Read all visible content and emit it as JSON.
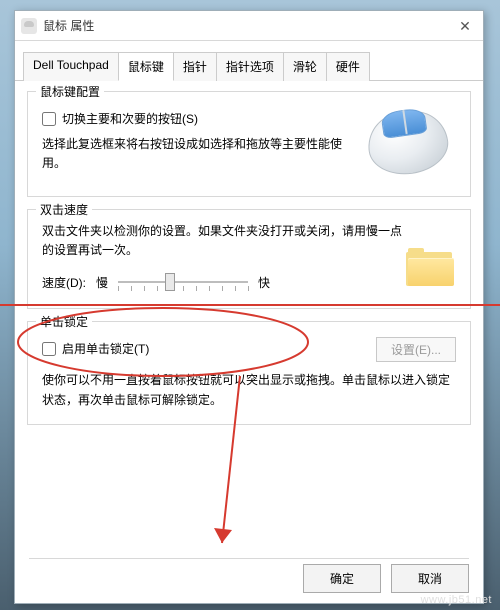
{
  "window": {
    "title": "鼠标 属性"
  },
  "tabs": [
    "Dell Touchpad",
    "鼠标键",
    "指针",
    "指针选项",
    "滑轮",
    "硬件"
  ],
  "active_tab_index": 1,
  "group1": {
    "title": "鼠标键配置",
    "checkbox_label": "切换主要和次要的按钮(S)",
    "checkbox_checked": false,
    "desc": "选择此复选框来将右按钮设成如选择和拖放等主要性能使用。"
  },
  "group2": {
    "title": "双击速度",
    "desc": "双击文件夹以检测你的设置。如果文件夹没打开或关闭，请用慢一点的设置再试一次。",
    "speed_label": "速度(D):",
    "slow_label": "慢",
    "fast_label": "快",
    "slider_value": 4,
    "slider_min": 0,
    "slider_max": 10
  },
  "group3": {
    "title": "单击锁定",
    "checkbox_label": "启用单击锁定(T)",
    "checkbox_checked": false,
    "settings_button": "设置(E)...",
    "settings_enabled": false,
    "desc": "使你可以不用一直按着鼠标按钮就可以突出显示或拖拽。单击鼠标以进入锁定状态，再次单击鼠标可解除锁定。"
  },
  "footer": {
    "ok": "确定",
    "cancel": "取消"
  },
  "watermark": "www.jb51.net"
}
